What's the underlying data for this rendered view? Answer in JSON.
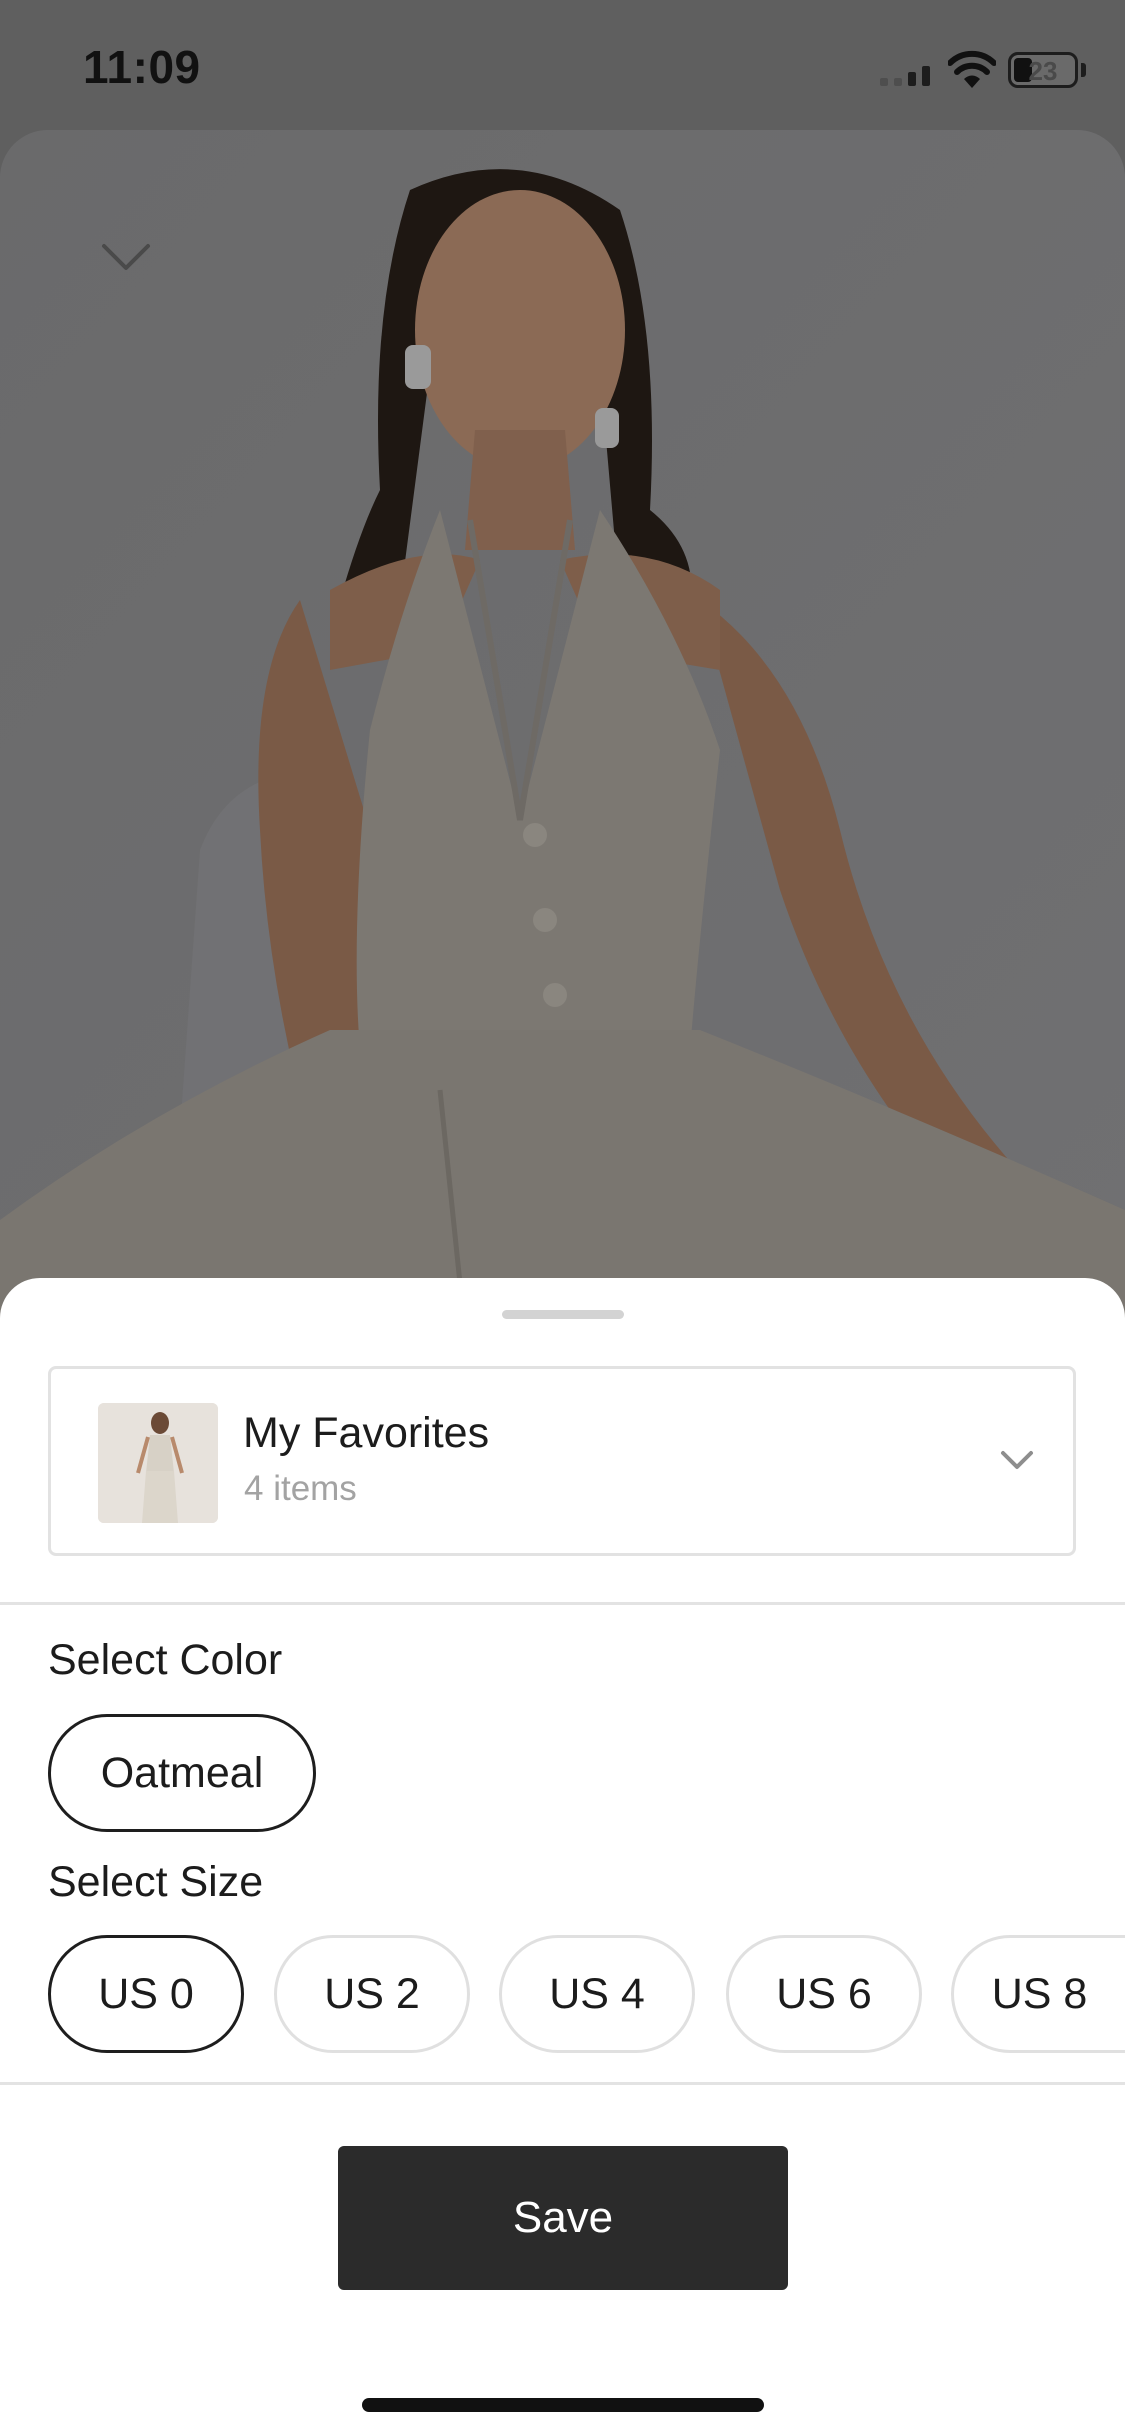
{
  "status_bar": {
    "time": "11:09",
    "battery": "23"
  },
  "product": {
    "image_alt": "Model wearing oatmeal halter vest and trousers",
    "dimmed_overlay_color": "#5f5f5f",
    "garment_color": "#c9c4ba"
  },
  "sheet": {
    "list": {
      "name": "My Favorites",
      "count": "4 items"
    },
    "color": {
      "label": "Select Color",
      "options": [
        "Oatmeal"
      ],
      "selected": "Oatmeal"
    },
    "size": {
      "label": "Select Size",
      "options": [
        "US 0",
        "US 2",
        "US 4",
        "US 6",
        "US 8"
      ],
      "selected": "US 0"
    },
    "save_label": "Save"
  },
  "icons": {
    "collapse": "chevron-down-icon",
    "list_dropdown": "chevron-down-icon",
    "signal": "cellular-signal-icon",
    "wifi": "wifi-icon",
    "battery": "battery-icon"
  }
}
